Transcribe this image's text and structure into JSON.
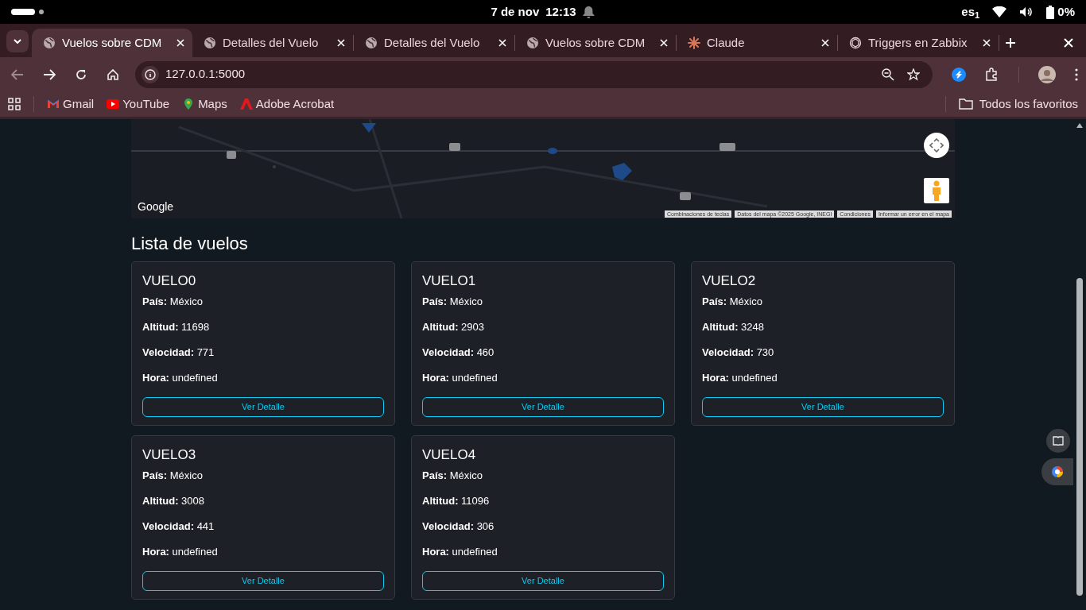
{
  "status_bar": {
    "date": "7 de nov",
    "time": "12:13",
    "keyboard": "es$_{1}$",
    "battery": "0%"
  },
  "tabs": [
    {
      "title": "Vuelos sobre CDM",
      "kind": "globe",
      "selected": true
    },
    {
      "title": "Detalles del Vuelo",
      "kind": "globe",
      "selected": false
    },
    {
      "title": "Detalles del Vuelo",
      "kind": "globe",
      "selected": false
    },
    {
      "title": "Vuelos sobre CDM",
      "kind": "globe",
      "selected": false
    },
    {
      "title": "Claude",
      "kind": "burst",
      "selected": false
    },
    {
      "title": "Triggers en Zabbix",
      "kind": "knot",
      "selected": false
    }
  ],
  "address": "127.0.0.1:5000",
  "bookmarks": [
    {
      "label": "Gmail",
      "kind": "mail"
    },
    {
      "label": "YouTube",
      "kind": "play"
    },
    {
      "label": "Maps",
      "kind": "pin"
    },
    {
      "label": "Adobe Acrobat",
      "kind": "acrobat"
    }
  ],
  "all_bookmarks": "Todos los favoritos",
  "map": {
    "kind": "picture",
    "logo": "Google",
    "attribution": [
      "Combinaciones de teclas",
      "Datos del mapa ©2025 Google, INEGI",
      "Condiciones",
      "Informar un error en el mapa"
    ]
  },
  "heading": "Lista de vuelos",
  "flights": [
    {
      "name": "VUELO0",
      "fields": [
        {
          "label": "País:",
          "value": "México"
        },
        {
          "label": "Altitud:",
          "value": "11698"
        },
        {
          "label": "Velocidad:",
          "value": "771"
        },
        {
          "label": "Hora:",
          "value": "undefined"
        }
      ],
      "button": "Ver Detalle"
    },
    {
      "name": "VUELO1",
      "fields": [
        {
          "label": "País:",
          "value": "México"
        },
        {
          "label": "Altitud:",
          "value": "2903"
        },
        {
          "label": "Velocidad:",
          "value": "460"
        },
        {
          "label": "Hora:",
          "value": "undefined"
        }
      ],
      "button": "Ver Detalle"
    },
    {
      "name": "VUELO2",
      "fields": [
        {
          "label": "País:",
          "value": "México"
        },
        {
          "label": "Altitud:",
          "value": "3248"
        },
        {
          "label": "Velocidad:",
          "value": "730"
        },
        {
          "label": "Hora:",
          "value": "undefined"
        }
      ],
      "button": "Ver Detalle"
    },
    {
      "name": "VUELO3",
      "fields": [
        {
          "label": "País:",
          "value": "México"
        },
        {
          "label": "Altitud:",
          "value": "3008"
        },
        {
          "label": "Velocidad:",
          "value": "441"
        },
        {
          "label": "Hora:",
          "value": "undefined"
        }
      ],
      "button": "Ver Detalle"
    },
    {
      "name": "VUELO4",
      "fields": [
        {
          "label": "País:",
          "value": "México"
        },
        {
          "label": "Altitud:",
          "value": "11096"
        },
        {
          "label": "Velocidad:",
          "value": "306"
        },
        {
          "label": "Hora:",
          "value": "undefined"
        }
      ],
      "button": "Ver Detalle"
    }
  ]
}
